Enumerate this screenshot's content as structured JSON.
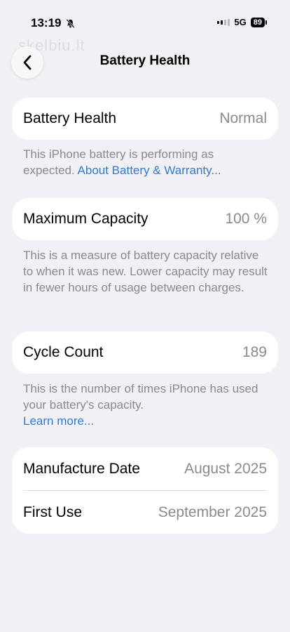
{
  "status_bar": {
    "time": "13:19",
    "network": "5G",
    "battery_level": "89"
  },
  "watermark": "skelbiu.lt",
  "nav": {
    "title": "Battery Health"
  },
  "battery_health": {
    "label": "Battery Health",
    "value": "Normal",
    "footnote": "This iPhone battery is performing as expected.",
    "link": "About Battery & Warranty..."
  },
  "maximum_capacity": {
    "label": "Maximum Capacity",
    "value": "100 %",
    "footnote": "This is a measure of battery capacity relative to when it was new. Lower capacity may result in fewer hours of usage between charges."
  },
  "cycle_count": {
    "label": "Cycle Count",
    "value": "189",
    "footnote": "This is the number of times iPhone has used your battery's capacity.",
    "link": "Learn more..."
  },
  "dates": {
    "manufacture_label": "Manufacture Date",
    "manufacture_value": "August 2025",
    "first_use_label": "First Use",
    "first_use_value": "September 2025"
  },
  "colors": {
    "background": "#f1f1f5",
    "card": "#ffffff",
    "secondary_text": "#8a8a8e",
    "link": "#2e7bd6"
  }
}
